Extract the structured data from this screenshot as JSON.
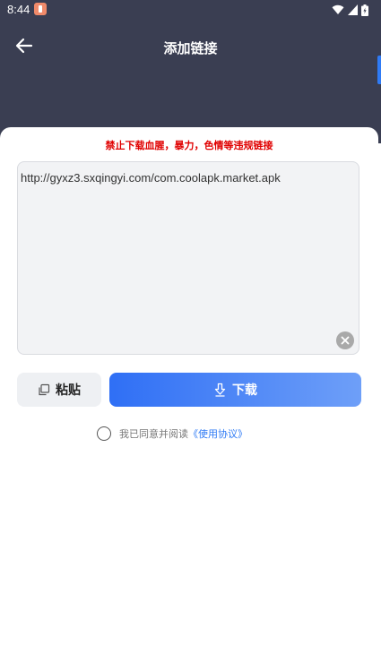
{
  "status_bar": {
    "time": "8:44"
  },
  "header": {
    "title": "添加链接"
  },
  "form": {
    "warning": "禁止下载血腥，暴力，色情等违规链接",
    "link_value": "http://gyxz3.sxqingyi.com/com.coolapk.market.apk",
    "paste_label": "粘贴",
    "download_label": "下载"
  },
  "agreement": {
    "text": "我已同意并阅读",
    "link": "《使用协议》"
  },
  "colors": {
    "header_bg": "#3a3e52",
    "warning": "#e00000",
    "accent": "#2f7bf5"
  },
  "icons": {
    "back": "arrow-left-icon",
    "wifi": "wifi-icon",
    "signal": "signal-icon",
    "battery": "battery-icon",
    "clear": "clear-icon",
    "paste": "paste-icon",
    "download": "download-icon"
  }
}
